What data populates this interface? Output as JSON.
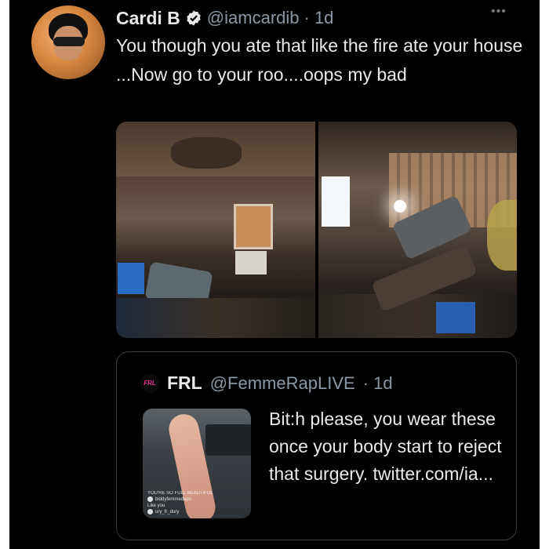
{
  "tweet": {
    "author_name": "Cardi B",
    "author_handle": "@iamcardib",
    "timestamp": "· 1d",
    "text": "You though you ate that like the fire ate your house ...Now go to your roo....oops my bad",
    "more_icon": "more-horizontal-icon",
    "verified": true,
    "media": [
      {
        "alt": "burned room with ceiling fan and window"
      },
      {
        "alt": "burned room with collapsed chair and wall panels"
      }
    ]
  },
  "quoted_tweet": {
    "avatar_label": "FRL",
    "author_name": "FRL",
    "author_handle": "@FemmeRapLIVE",
    "timestamp": "· 1d",
    "text": "Bit:h please, you wear these once your body start to reject that surgery. twitter.com/ia...",
    "thumbnail_caption": [
      "YOU'RE SO FULL BEAUTIFUL",
      "biddyfemmedaps",
      "Like you",
      "ury_fr_dury"
    ]
  },
  "colors": {
    "background": "#000000",
    "text_primary": "#e7e9ea",
    "text_secondary": "#8b98a5",
    "verified": "#e7e9ea",
    "card_border": "#3a3f44",
    "frl_accent": "#e8308c"
  }
}
